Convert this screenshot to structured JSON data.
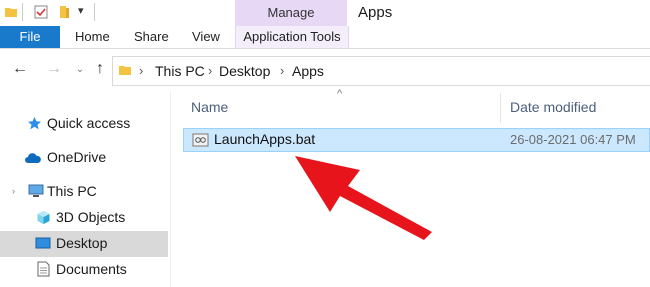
{
  "window": {
    "title": "Apps"
  },
  "ribbon": {
    "context_group": "Manage",
    "tabs": {
      "file": "File",
      "home": "Home",
      "share": "Share",
      "view": "View",
      "application_tools": "Application Tools"
    }
  },
  "address_bar": {
    "crumbs": [
      "This PC",
      "Desktop",
      "Apps"
    ]
  },
  "sidebar": {
    "items": [
      {
        "label": "Quick access",
        "icon": "star-icon"
      },
      {
        "label": "OneDrive",
        "icon": "cloud-icon"
      },
      {
        "label": "This PC",
        "icon": "computer-icon"
      },
      {
        "label": "3D Objects",
        "icon": "cube-icon"
      },
      {
        "label": "Desktop",
        "icon": "desktop-icon",
        "selected": true
      },
      {
        "label": "Documents",
        "icon": "document-icon"
      }
    ]
  },
  "file_list": {
    "columns": {
      "name": "Name",
      "date_modified": "Date modified"
    },
    "rows": [
      {
        "name": "LaunchApps.bat",
        "date_modified": "26-08-2021 06:47 PM",
        "selected": true
      }
    ]
  },
  "colors": {
    "file_tab": "#1979ca",
    "manage_tab": "#e7d8f6",
    "selection": "#cce8ff",
    "arrow": "#e8141c"
  }
}
